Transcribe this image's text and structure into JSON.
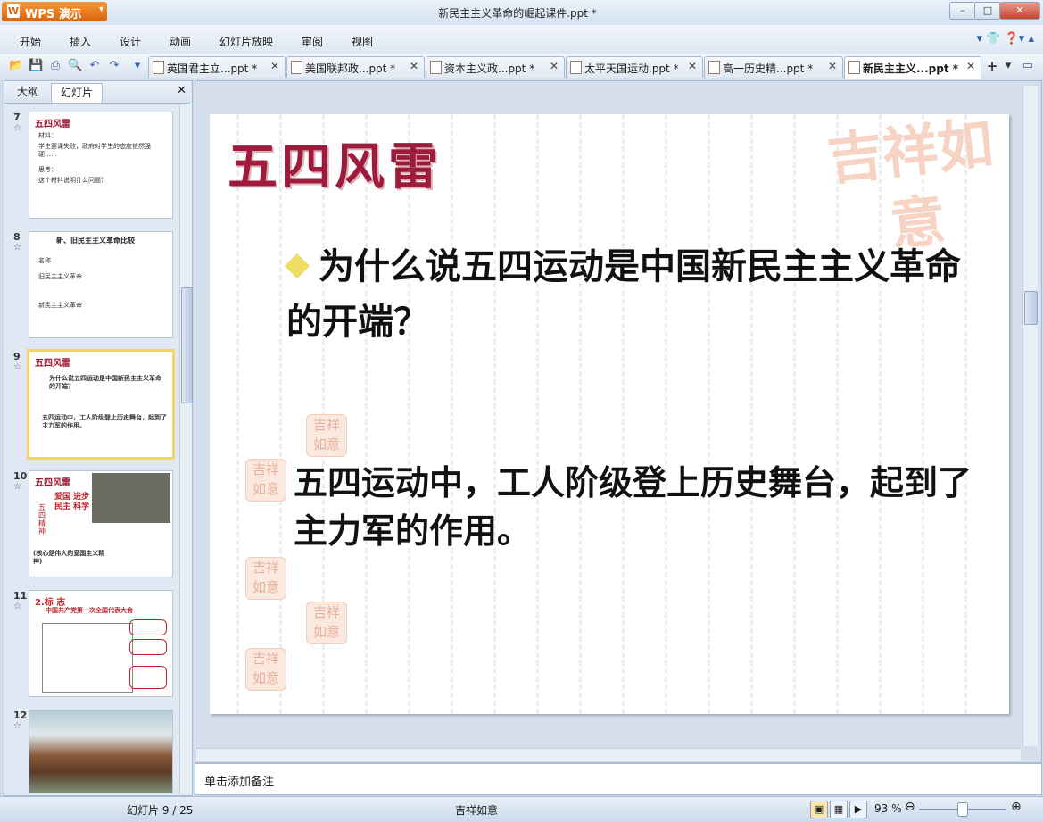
{
  "app": {
    "name": "WPS 演示",
    "doc_title": "新民主主义革命的崛起课件.ppt *"
  },
  "menu": [
    "开始",
    "插入",
    "设计",
    "动画",
    "幻灯片放映",
    "审阅",
    "视图"
  ],
  "tabs": [
    {
      "label": "英国君主立...ppt *"
    },
    {
      "label": "美国联邦政...ppt *"
    },
    {
      "label": "资本主义政...ppt *"
    },
    {
      "label": "太平天国运动.ppt *"
    },
    {
      "label": "高一历史精...ppt *"
    },
    {
      "label": "新民主主义...ppt *"
    }
  ],
  "left_panel": {
    "tab_outline": "大纲",
    "tab_slides": "幻灯片",
    "thumbs": [
      {
        "num": "7",
        "title": "五四风雷",
        "lines": [
          "材料：",
          "学生罢课失败，政府对学生的态度依然强硬……",
          "思考：",
          "这个材料说明什么问题？"
        ]
      },
      {
        "num": "8",
        "title": "新、旧民主主义革命比较",
        "lines": [
          "名称",
          "旧民主主义革命",
          "新民主主义革命"
        ]
      },
      {
        "num": "9",
        "title": "五四风雷",
        "lines": [
          "为什么说五四运动是中国新民主主义革命的开端？",
          "五四运动中，工人阶级登上历史舞台，起到了主力军的作用。"
        ]
      },
      {
        "num": "10",
        "title": "五四风雷",
        "lines": [
          "爱国 进步 民主 科学",
          "五四精神",
          "(核心是伟大的爱国主义精神)"
        ]
      },
      {
        "num": "11",
        "title": "2.标 志",
        "lines": [
          "中国共产党第一次全国代表大会"
        ]
      },
      {
        "num": "12",
        "title": "",
        "lines": []
      }
    ]
  },
  "slide": {
    "title": "五四风雷",
    "question": "为什么说五四运动是中国新民主主义革命的开端？",
    "answer": "五四运动中，工人阶级登上历史舞台，起到了主力军的作用。",
    "watermark": "吉祥如意"
  },
  "notes": {
    "placeholder": "单击添加备注"
  },
  "status": {
    "slide_counter": "幻灯片 9 / 25",
    "theme": "吉祥如意",
    "zoom": "93 %"
  },
  "colors": {
    "title": "#9e1b3c",
    "bullet": "#eede66",
    "selected_thumb": "#f3d36a"
  }
}
